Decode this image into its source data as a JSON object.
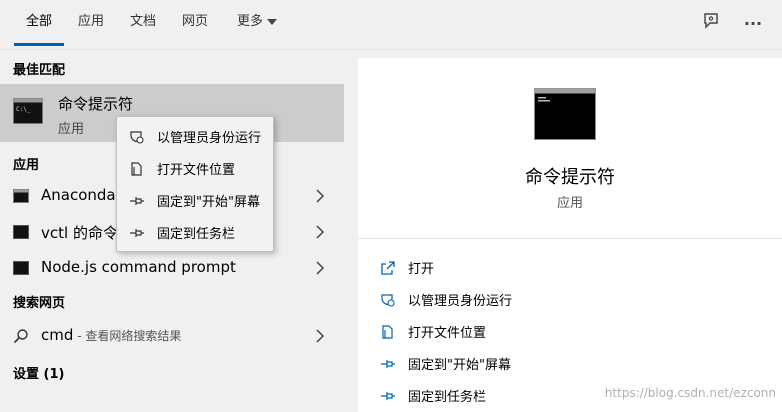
{
  "tabs": [
    {
      "label": "全部",
      "active": true
    },
    {
      "label": "应用"
    },
    {
      "label": "文档"
    },
    {
      "label": "网页"
    },
    {
      "label": "更多"
    }
  ],
  "top_icons": {
    "feedback": "feedback-icon",
    "more": "···"
  },
  "sections": {
    "best_match": "最佳匹配",
    "apps": "应用",
    "web": "搜索网页",
    "settings": "设置 (1)"
  },
  "best_match": {
    "name": "命令提示符",
    "type": "应用"
  },
  "apps": [
    {
      "label": "Anaconda"
    },
    {
      "label": "vctl 的命令"
    },
    {
      "label": "Node.js command prompt"
    }
  ],
  "web_result": {
    "query": "cmd",
    "hint": " - 查看网络搜索结果"
  },
  "context_menu": [
    {
      "label": "以管理员身份运行",
      "icon": "shield-icon"
    },
    {
      "label": "打开文件位置",
      "icon": "file-location-icon"
    },
    {
      "label": "固定到\"开始\"屏幕",
      "icon": "pin-icon"
    },
    {
      "label": "固定到任务栏",
      "icon": "pin-icon"
    }
  ],
  "detail": {
    "title": "命令提示符",
    "subtitle": "应用",
    "actions": [
      {
        "label": "打开",
        "icon": "open-icon"
      },
      {
        "label": "以管理员身份运行",
        "icon": "shield-icon"
      },
      {
        "label": "打开文件位置",
        "icon": "file-location-icon"
      },
      {
        "label": "固定到\"开始\"屏幕",
        "icon": "pin-icon"
      },
      {
        "label": "固定到任务栏",
        "icon": "pin-icon"
      }
    ]
  },
  "watermark": "https://blog.csdn.net/ezconn",
  "colors": {
    "accent": "#0063b1",
    "selected_bg": "#cccccc",
    "panel_bg": "#f0f0f0"
  }
}
